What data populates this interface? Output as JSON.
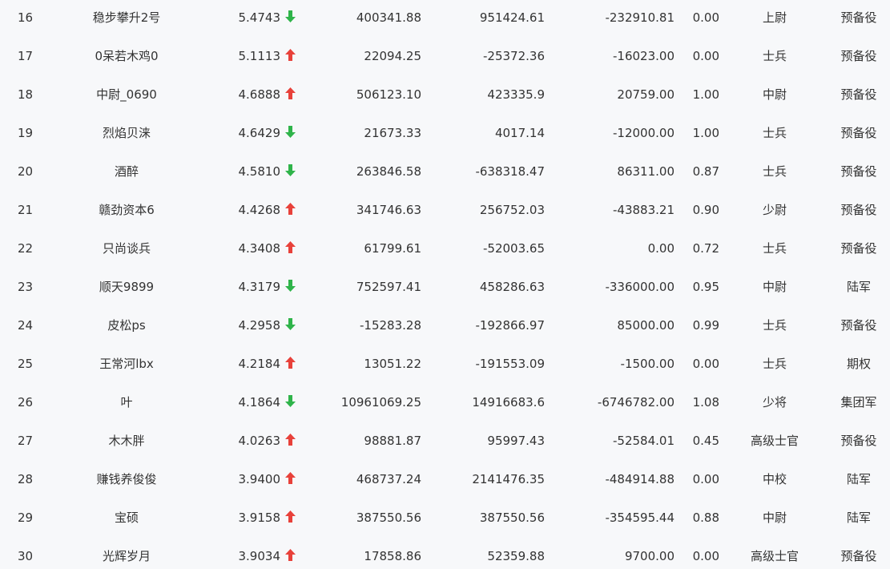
{
  "colors": {
    "up": "#e8413a",
    "down": "#2fb44a"
  },
  "rows": [
    {
      "rank": "16",
      "name": "稳步攀升2号",
      "score": "5.4743",
      "trend": "down",
      "v1": "400341.88",
      "v2": "951424.61",
      "v3": "-232910.81",
      "ratio": "0.00",
      "title": "上尉",
      "type": "预备役"
    },
    {
      "rank": "17",
      "name": "0呆若木鸡0",
      "score": "5.1113",
      "trend": "up",
      "v1": "22094.25",
      "v2": "-25372.36",
      "v3": "-16023.00",
      "ratio": "0.00",
      "title": "士兵",
      "type": "预备役"
    },
    {
      "rank": "18",
      "name": "中尉_0690",
      "score": "4.6888",
      "trend": "up",
      "v1": "506123.10",
      "v2": "423335.9",
      "v3": "20759.00",
      "ratio": "1.00",
      "title": "中尉",
      "type": "预备役"
    },
    {
      "rank": "19",
      "name": "烈焰贝涞",
      "score": "4.6429",
      "trend": "down",
      "v1": "21673.33",
      "v2": "4017.14",
      "v3": "-12000.00",
      "ratio": "1.00",
      "title": "士兵",
      "type": "预备役"
    },
    {
      "rank": "20",
      "name": "酒醉",
      "score": "4.5810",
      "trend": "down",
      "v1": "263846.58",
      "v2": "-638318.47",
      "v3": "86311.00",
      "ratio": "0.87",
      "title": "士兵",
      "type": "预备役"
    },
    {
      "rank": "21",
      "name": "赣劲资本6",
      "score": "4.4268",
      "trend": "up",
      "v1": "341746.63",
      "v2": "256752.03",
      "v3": "-43883.21",
      "ratio": "0.90",
      "title": "少尉",
      "type": "预备役"
    },
    {
      "rank": "22",
      "name": "只尚谈兵",
      "score": "4.3408",
      "trend": "up",
      "v1": "61799.61",
      "v2": "-52003.65",
      "v3": "0.00",
      "ratio": "0.72",
      "title": "士兵",
      "type": "预备役"
    },
    {
      "rank": "23",
      "name": "顺天9899",
      "score": "4.3179",
      "trend": "down",
      "v1": "752597.41",
      "v2": "458286.63",
      "v3": "-336000.00",
      "ratio": "0.95",
      "title": "中尉",
      "type": "陆军"
    },
    {
      "rank": "24",
      "name": "皮松ps",
      "score": "4.2958",
      "trend": "down",
      "v1": "-15283.28",
      "v2": "-192866.97",
      "v3": "85000.00",
      "ratio": "0.99",
      "title": "士兵",
      "type": "预备役"
    },
    {
      "rank": "25",
      "name": "王常河lbx",
      "score": "4.2184",
      "trend": "up",
      "v1": "13051.22",
      "v2": "-191553.09",
      "v3": "-1500.00",
      "ratio": "0.00",
      "title": "士兵",
      "type": "期权"
    },
    {
      "rank": "26",
      "name": "叶",
      "score": "4.1864",
      "trend": "down",
      "v1": "10961069.25",
      "v2": "14916683.6",
      "v3": "-6746782.00",
      "ratio": "1.08",
      "title": "少将",
      "type": "集团军"
    },
    {
      "rank": "27",
      "name": "木木胖",
      "score": "4.0263",
      "trend": "up",
      "v1": "98881.87",
      "v2": "95997.43",
      "v3": "-52584.01",
      "ratio": "0.45",
      "title": "高级士官",
      "type": "预备役"
    },
    {
      "rank": "28",
      "name": "赚钱养俊俊",
      "score": "3.9400",
      "trend": "up",
      "v1": "468737.24",
      "v2": "2141476.35",
      "v3": "-484914.88",
      "ratio": "0.00",
      "title": "中校",
      "type": "陆军"
    },
    {
      "rank": "29",
      "name": "宝硕",
      "score": "3.9158",
      "trend": "up",
      "v1": "387550.56",
      "v2": "387550.56",
      "v3": "-354595.44",
      "ratio": "0.88",
      "title": "中尉",
      "type": "陆军"
    },
    {
      "rank": "30",
      "name": "光辉岁月",
      "score": "3.9034",
      "trend": "up",
      "v1": "17858.86",
      "v2": "52359.88",
      "v3": "9700.00",
      "ratio": "0.00",
      "title": "高级士官",
      "type": "预备役"
    }
  ]
}
